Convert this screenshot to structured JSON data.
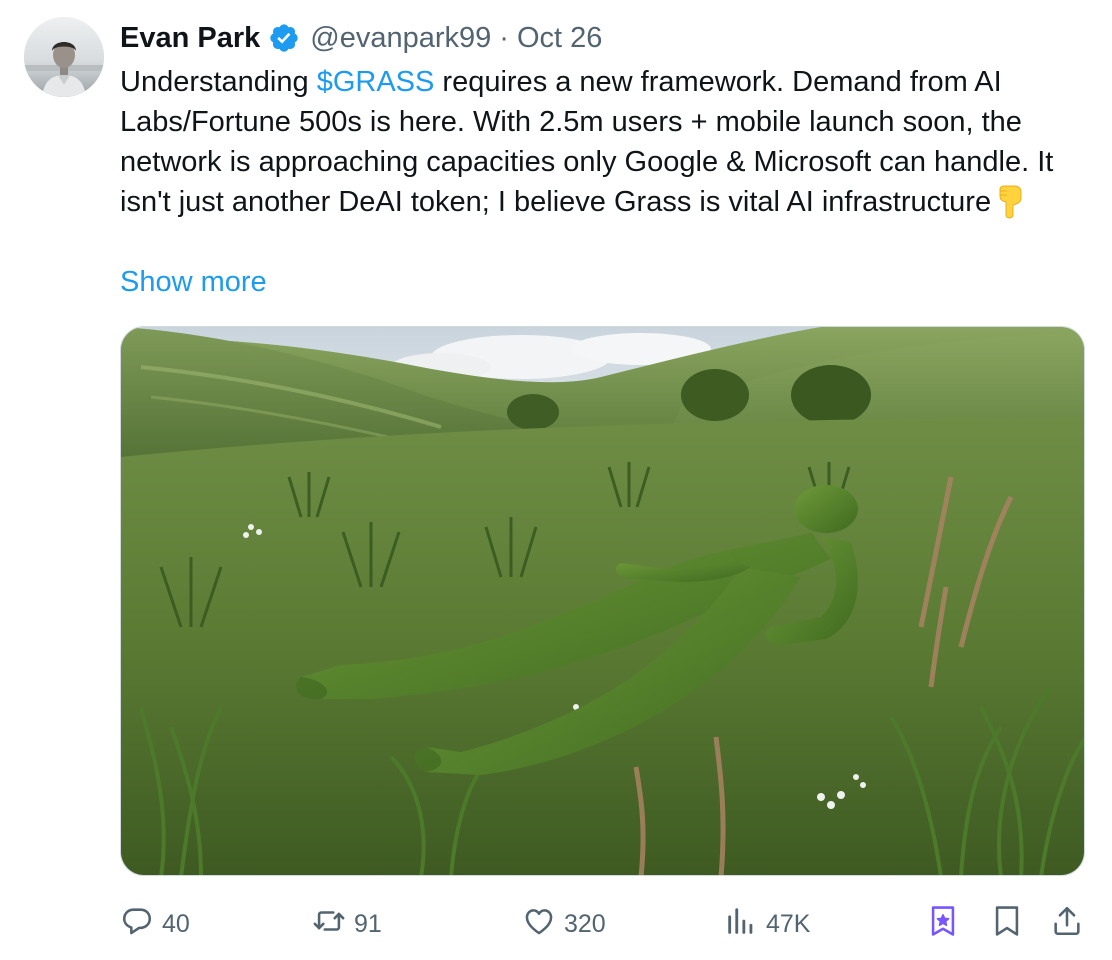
{
  "tweet": {
    "author_name": "Evan Park",
    "handle": "@evanpark99",
    "separator": "·",
    "date": "Oct 26",
    "text_before": "Understanding ",
    "cashtag": "$GRASS",
    "text_after": " requires a new framework. Demand from AI Labs/Fortune 500s is here. With 2.5m users + mobile launch soon, the network is approaching capacities only Google & Microsoft can handle. It isn't just another DeAI token; I believe Grass is vital AI infrastructure",
    "emoji": "point-down-emoji",
    "show_more": "Show more"
  },
  "actions": {
    "replies": "40",
    "reposts": "91",
    "likes": "320",
    "views": "47K"
  },
  "colors": {
    "link": "#1d9bf0",
    "secondary": "#536471",
    "verified": "#1d9bf0",
    "grok": "#7856ff"
  },
  "icons": [
    "verified-badge-icon",
    "reply-icon",
    "repost-icon",
    "like-icon",
    "views-icon",
    "grok-icon",
    "bookmark-icon",
    "share-icon"
  ]
}
